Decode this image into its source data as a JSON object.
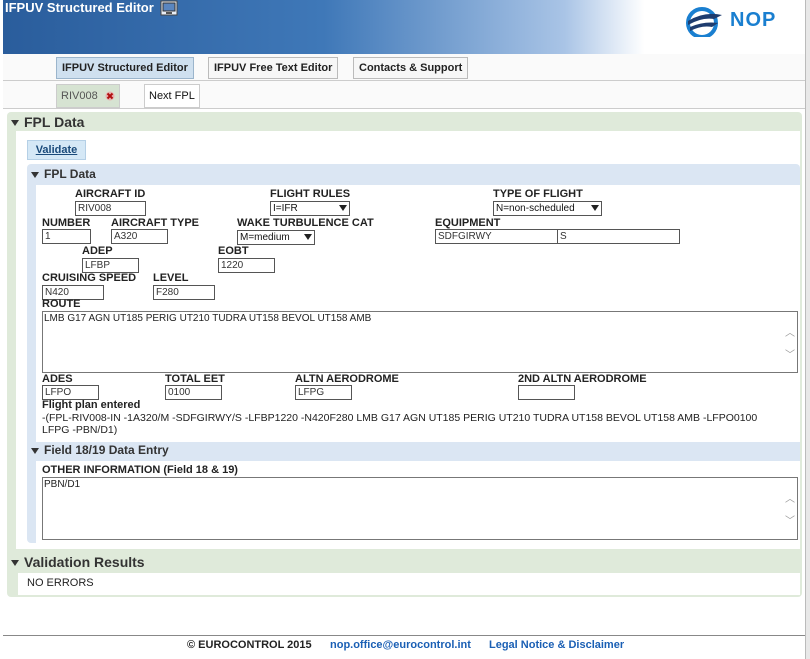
{
  "app": {
    "title": "IFPUV Structured Editor",
    "brand": "NOP"
  },
  "tabs": [
    "IFPUV Structured Editor",
    "IFPUV Free Text Editor",
    "Contacts & Support"
  ],
  "subtabs": [
    "RIV008",
    "Next FPL"
  ],
  "sections": {
    "fpl_outer": "FPL Data",
    "fpl_inner": "FPL Data",
    "field1819": "Field 18/19 Data Entry",
    "validation": "Validation Results"
  },
  "validate_label": "Validate",
  "form": {
    "aircraft_id": {
      "label": "AIRCRAFT ID",
      "value": "RIV008"
    },
    "flight_rules": {
      "label": "FLIGHT RULES",
      "value": "I=IFR"
    },
    "type_of_flight": {
      "label": "TYPE OF FLIGHT",
      "value": "N=non-scheduled"
    },
    "number": {
      "label": "NUMBER",
      "value": "1"
    },
    "aircraft_type": {
      "label": "AIRCRAFT TYPE",
      "value": "A320"
    },
    "wake": {
      "label": "WAKE TURBULENCE CAT",
      "value": "M=medium"
    },
    "equipment": {
      "label": "EQUIPMENT",
      "value1": "SDFGIRWY",
      "value2": "S"
    },
    "adep": {
      "label": "ADEP",
      "value": "LFBP"
    },
    "eobt": {
      "label": "EOBT",
      "value": "1220"
    },
    "cruising_speed": {
      "label": "CRUISING SPEED",
      "value": "N420"
    },
    "level": {
      "label": "LEVEL",
      "value": "F280"
    },
    "route": {
      "label": "ROUTE",
      "value": "LMB G17 AGN UT185 PERIG UT210 TUDRA UT158 BEVOL UT158 AMB"
    },
    "ades": {
      "label": "ADES",
      "value": "LFPO"
    },
    "total_eet": {
      "label": "TOTAL EET",
      "value": "0100"
    },
    "altn": {
      "label": "ALTN AERODROME",
      "value": "LFPG"
    },
    "altn2": {
      "label": "2ND ALTN AERODROME",
      "value": ""
    },
    "fp_entered_label": "Flight plan entered",
    "fp_entered_line1": "-(FPL-RIV008-IN -1A320/M -SDFGIRWY/S -LFBP1220 -N420F280 LMB G17 AGN UT185 PERIG UT210 TUDRA UT158 BEVOL UT158 AMB -LFPO0100",
    "fp_entered_line2": "LFPG -PBN/D1)",
    "other_info": {
      "label": "OTHER INFORMATION (Field 18 & 19)",
      "value": "PBN/D1"
    }
  },
  "validation_text": "NO ERRORS",
  "footer": {
    "copyright": "© EUROCONTROL 2015",
    "email": "nop.office@eurocontrol.int",
    "legal": "Legal Notice & Disclaimer"
  },
  "colors": {
    "link": "#1a5fb4",
    "header_blue": "#2a5d9c",
    "panel_green": "#dfeada",
    "panel_blue": "#dbe6f3"
  }
}
